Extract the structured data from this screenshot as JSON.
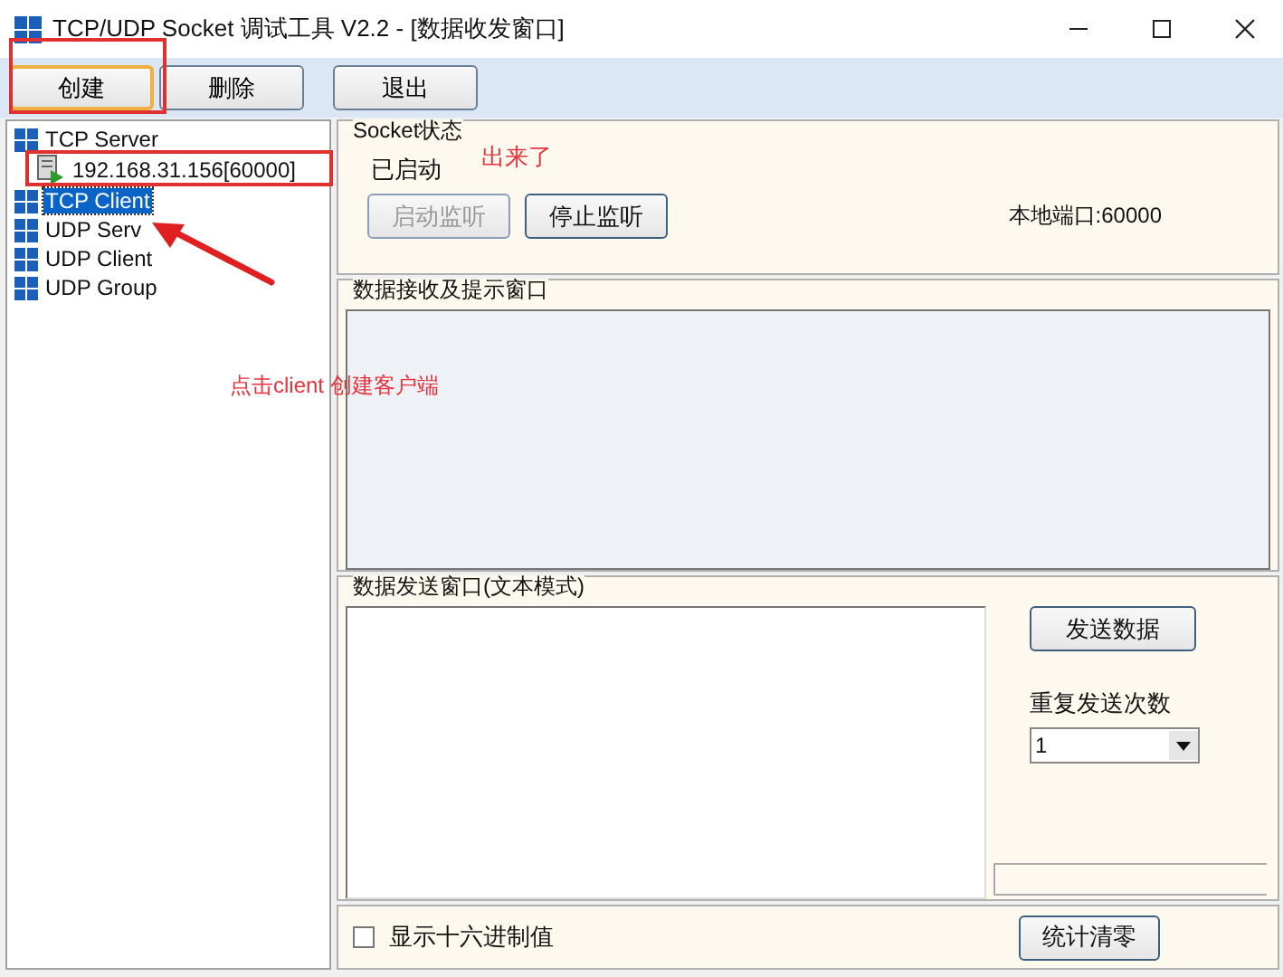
{
  "window": {
    "title": "TCP/UDP Socket 调试工具 V2.2 - [数据收发窗口]"
  },
  "toolbar": {
    "buttons": [
      {
        "label": "创建",
        "focused": true
      },
      {
        "label": "删除",
        "focused": false
      },
      {
        "label": "退出",
        "focused": false
      }
    ]
  },
  "tree": {
    "items": [
      {
        "label": "TCP Server",
        "selected": false,
        "children": [
          {
            "label": "192.168.31.156[60000]",
            "selected": false
          }
        ]
      },
      {
        "label": "TCP Client",
        "selected": true
      },
      {
        "label": "UDP Serv",
        "selected": false
      },
      {
        "label": "UDP Client",
        "selected": false
      },
      {
        "label": "UDP Group",
        "selected": false
      }
    ]
  },
  "socket_status": {
    "title": "Socket状态",
    "status": "已启动",
    "buttons": [
      {
        "label": "启动监听",
        "disabled": true
      },
      {
        "label": "停止监听",
        "disabled": false
      }
    ],
    "local_port": "本地端口:60000"
  },
  "receive_panel": {
    "title": "数据接收及提示窗口"
  },
  "send_panel": {
    "title": "数据发送窗口(文本模式)",
    "send_button": "发送数据",
    "repeat_label": "重复发送次数",
    "repeat_count": "1"
  },
  "bottom_bar": {
    "hex_checkbox": {
      "label": "显示十六进制值",
      "checked": false
    },
    "reset_button": "统计清零"
  },
  "annotations": [
    {
      "text": "出来了",
      "color": "#e8323c"
    },
    {
      "text": "点击client 创建客户端",
      "color": "#e8323c"
    }
  ]
}
